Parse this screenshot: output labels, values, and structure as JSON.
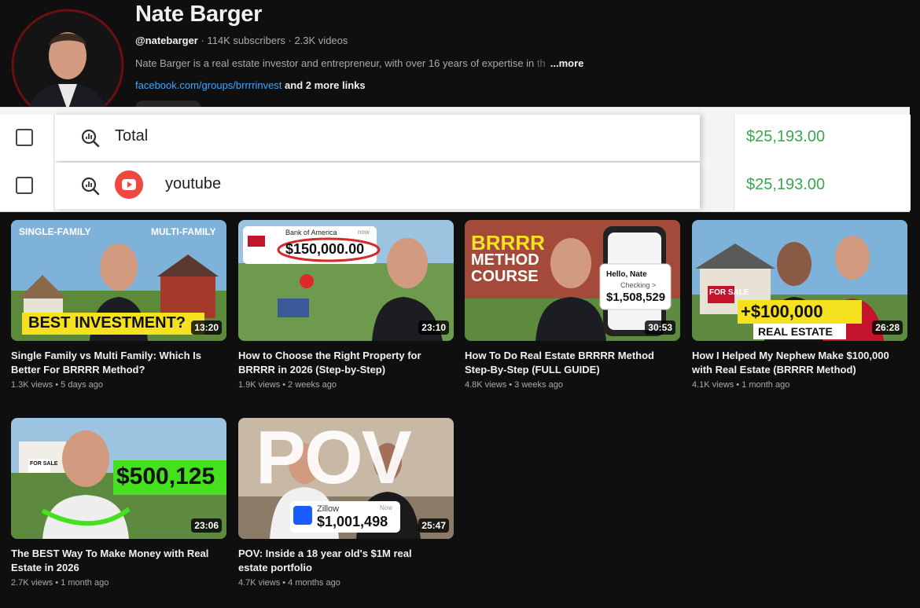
{
  "channel": {
    "name": "Nate Barger",
    "handle": "@natebarger",
    "stats": " · 114K subscribers · 2.3K videos",
    "description": "Nate Barger is a real estate investor and entrepreneur, with over 16 years of expertise in",
    "description_fade": " th",
    "more_label": "...more",
    "link": "facebook.com/groups/brrrrinvest",
    "more_links": " and 2 more links"
  },
  "overlay": {
    "rows": [
      {
        "label": "Total",
        "value": "$25,193.00"
      },
      {
        "label": "youtube",
        "value": "$25,193.00"
      }
    ]
  },
  "videos": [
    {
      "title": "Single Family vs Multi Family: Which Is Better For BRRRR Method?",
      "views": "1.3K views",
      "age": "5 days ago",
      "duration": "13:20",
      "thumb_text": [
        "SINGLE-FAMILY",
        "MULTI-FAMILY",
        "BEST INVESTMENT?"
      ]
    },
    {
      "title": "How to Choose the Right Property for BRRRR in 2026 (Step-by-Step)",
      "views": "1.9K views",
      "age": "2 weeks ago",
      "duration": "23:10",
      "thumb_text": [
        "Bank of America",
        "$150,000.00",
        "now"
      ]
    },
    {
      "title": "How To Do Real Estate BRRRR Method Step-By-Step (FULL GUIDE)",
      "views": "4.8K views",
      "age": "3 weeks ago",
      "duration": "30:53",
      "thumb_text": [
        "BRRRR",
        "METHOD",
        "COURSE",
        "Hello, Nate",
        "Checking >",
        "$1,508,529"
      ]
    },
    {
      "title": "How I Helped My Nephew Make $100,000 with Real Estate (BRRRR Method)",
      "views": "4.1K views",
      "age": "1 month ago",
      "duration": "26:28",
      "thumb_text": [
        "FOR SALE",
        "+$100,000",
        "REAL ESTATE"
      ]
    },
    {
      "title": "The BEST Way To Make Money with Real Estate in 2026",
      "views": "2.7K views",
      "age": "1 month ago",
      "duration": "23:06",
      "thumb_text": [
        "FOR SALE",
        "$500,125"
      ]
    },
    {
      "title": "POV: Inside a 18 year old's $1M real estate portfolio",
      "views": "4.7K views",
      "age": "4 months ago",
      "duration": "25:47",
      "thumb_text": [
        "POV",
        "Zillow",
        "Now",
        "$1,001,498"
      ]
    }
  ],
  "colors": {
    "background": "#0f0f0f",
    "link": "#3ea6ff",
    "value_green": "#3aa651",
    "youtube_red": "#f0473f"
  }
}
